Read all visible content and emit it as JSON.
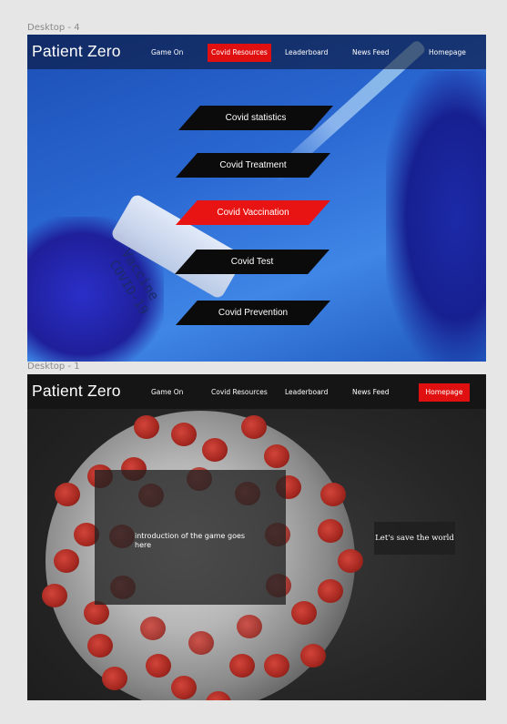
{
  "frames": {
    "resources": {
      "label": "Desktop - 4",
      "brand": "Patient Zero",
      "nav": [
        "Game On",
        "Covid Resources",
        "Leaderboard",
        "News Feed",
        "Homepage"
      ],
      "active_nav": "Covid Resources",
      "vial_text": [
        "Vaccine",
        "COVID-19"
      ],
      "buttons": [
        {
          "label": "Covid statistics",
          "active": false
        },
        {
          "label": "Covid Treatment",
          "active": false
        },
        {
          "label": "Covid Vaccination",
          "active": true
        },
        {
          "label": "Covid Test",
          "active": false
        },
        {
          "label": "Covid Prevention",
          "active": false
        }
      ]
    },
    "home": {
      "label": "Desktop - 1",
      "brand": "Patient Zero",
      "nav": [
        "Game On",
        "Covid Resources",
        "Leaderboard",
        "News Feed",
        "Homepage"
      ],
      "active_nav": "Homepage",
      "intro_text": "introduction of the game goes here",
      "cta_label": "Let's save the world"
    }
  },
  "colors": {
    "accent_red": "#e01010",
    "button_dark": "#0b0b0b",
    "hero_blue": "#2a67d1"
  }
}
